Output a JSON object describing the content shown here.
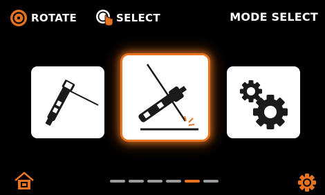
{
  "header": {
    "rotate_label": "ROTATE",
    "select_label": "SELECT",
    "title": "MODE SELECT"
  },
  "colors": {
    "accent": "#E8731F",
    "background": "#000000",
    "card": "#FFFFFF",
    "icon_dark": "#1A1A1A",
    "dot_inactive": "#9A9A9A"
  },
  "modes": [
    {
      "icon": "mig-torch-icon",
      "selected": false
    },
    {
      "icon": "tig-torch-icon",
      "selected": true
    },
    {
      "icon": "gears-settings-icon",
      "selected": false
    }
  ],
  "pagination": {
    "total": 6,
    "active_index": 4
  },
  "footer": {
    "left_icon": "home-icon",
    "right_icon": "gear-icon"
  }
}
